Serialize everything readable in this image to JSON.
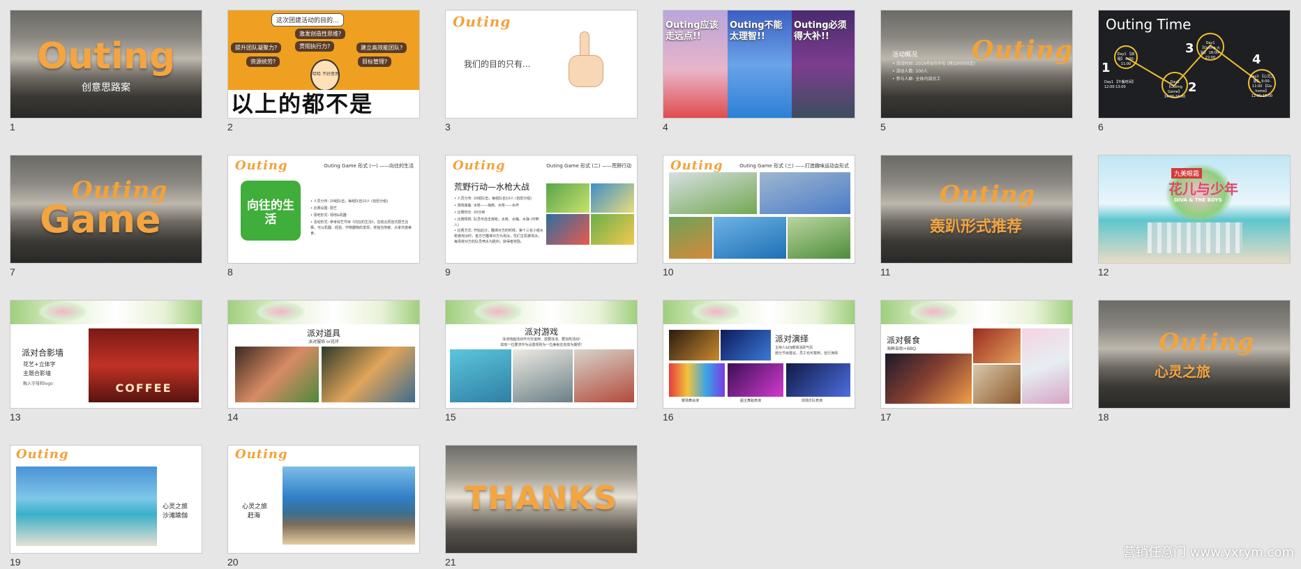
{
  "slides": [
    {
      "number": "1",
      "title": "Outing",
      "subtitle": "创意思路案"
    },
    {
      "number": "2",
      "question": "这次团建活动的目的...",
      "options": [
        "激发创造性思维?",
        "提升团队凝聚力?",
        "贯彻执行力?",
        "建立高效能团队?",
        "资源统劳?",
        "目标管理?"
      ],
      "character_label": "哈哈 不好意思",
      "bottom_text": "以上的都不是"
    },
    {
      "number": "3",
      "logo": "Outing",
      "text": "我们的目的只有..."
    },
    {
      "number": "4",
      "panels": [
        "Outing应该走远点!!",
        "Outing不能太理智!!",
        "Outing必须得大补!!"
      ]
    },
    {
      "number": "5",
      "logo": "Outing",
      "heading": "活动概况",
      "lines": [
        "• 活动时间: 2018年8月中旬 (两日时间待定)",
        "• 活动人数: 200人",
        "• 参与人群: 全体内部员工"
      ]
    },
    {
      "number": "6",
      "title": "Outing Time",
      "nodes": [
        {
          "digit": "1",
          "text": "Day1 【启程】 8:00-11:00"
        },
        {
          "digit": "",
          "text": "Day1 【午餐时间】 12:00-13:00"
        },
        {
          "digit": "2",
          "text": "Day1 【Outing Game】 14:00-16:00"
        },
        {
          "digit": "3",
          "text": "Day1 【Outing-火趴】 18:00-22:00"
        },
        {
          "digit": "4",
          "text": "Day2 【心灵之旅】 9:00-11:00 【Go home】 12:00-15:00"
        }
      ]
    },
    {
      "number": "7",
      "logo": "Outing",
      "title": "Game"
    },
    {
      "number": "8",
      "logo": "Outing",
      "title": "Outing Game 形式 (一) ——向往的生活",
      "badge": "向往的生活",
      "lines": [
        "• 人员分布: 20组队伍，每组队伍10人 (自愿分组)",
        "• 比赛设置: 厨艺",
        "• 场地形式: 场地&机器",
        "• 活动形式: 参考综艺节目《向往的生活》，在结合原创式厨艺比赛，可以机器、经验、作物器物的发现，将独当地被、大家共度美食。"
      ]
    },
    {
      "number": "9",
      "logo": "Outing",
      "title": "Outing Game 形式 (二) ——荒野行动",
      "heading": "荒野行动—水枪大战",
      "lines": [
        "• 人员分布: 20组队伍，每组队伍10人 (自愿分组)",
        "• 游戏装备: 水枪——海南、水枪——水炸",
        "• 比赛时长: 20分钟",
        "• 比赛规则: 队员可自击用枪，水枪、水桶、水弹 (可带入)",
        "• 比赛方式: 开始后分，瞄准对方的时候，第十三名小组水枪被淘汰时，各方已瞄准对方为淘汰，优们主机被淘汰，每场将对方的队员喷水为胜利，获得者奖励。"
      ]
    },
    {
      "number": "10",
      "logo": "Outing",
      "title": "Outing Game 形式 (三) ——打造趣味运动会形式"
    },
    {
      "number": "11",
      "logo": "Outing",
      "title": "轰趴形式推荐"
    },
    {
      "number": "12",
      "logo_top": "九美眼霜",
      "logo_main": "花儿与少年",
      "logo_sub": "DIVA & THE BOYS"
    },
    {
      "number": "13",
      "heading": "派对合影墙",
      "lines": [
        "花艺+立体字",
        "主题合影墙",
        "融入字母和logo"
      ],
      "sign": "COFFEE"
    },
    {
      "number": "14",
      "heading": "派对道具",
      "sub": "派对服饰 or花环"
    },
    {
      "number": "15",
      "heading": "派对游戏",
      "sub": [
        "泳池地面活动作为交谊用、放要泳池、要加热活动!",
        "如有一位要求作为设置规则为一位美就在有效为期项!"
      ]
    },
    {
      "number": "16",
      "heading": "派对演绎",
      "sub": [
        "主持人&DJ暖场活跃气氛",
        "部分节目建议，员工也可报到，自行演绎"
      ],
      "captions": [
        "暖场舞会演",
        "超主舞蹈表演",
        "现场乐队表演"
      ]
    },
    {
      "number": "17",
      "heading": "派对餐食",
      "sub": "海鲜自助+BBQ"
    },
    {
      "number": "18",
      "logo": "Outing",
      "title": "心灵之旅"
    },
    {
      "number": "19",
      "logo": "Outing",
      "lines": [
        "心灵之旅",
        "沙滩瑜伽"
      ]
    },
    {
      "number": "20",
      "logo": "Outing",
      "lines": [
        "心灵之旅",
        "赶海"
      ]
    },
    {
      "number": "21",
      "title": "THANKS"
    }
  ],
  "watermark": "营销任意门 www.yxrym.com"
}
